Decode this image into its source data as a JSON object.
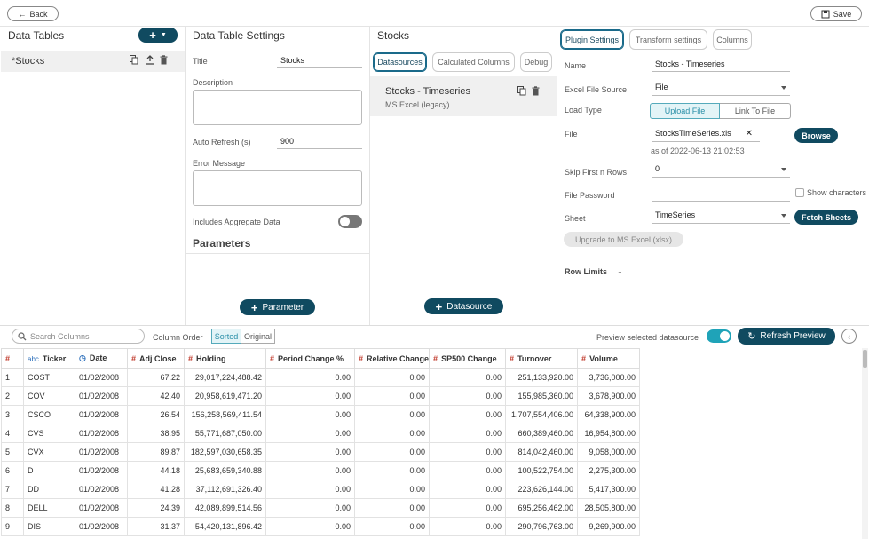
{
  "topbar": {
    "back_label": "Back",
    "save_label": "Save"
  },
  "data_tables": {
    "title": "Data Tables",
    "items": [
      {
        "label": "*Stocks"
      }
    ]
  },
  "settings": {
    "title": "Data Table Settings",
    "title_label": "Title",
    "title_value": "Stocks",
    "description_label": "Description",
    "auto_refresh_label": "Auto Refresh (s)",
    "auto_refresh_value": "900",
    "error_label": "Error Message",
    "aggregate_label": "Includes Aggregate Data",
    "parameters_title": "Parameters",
    "parameter_button": "Parameter"
  },
  "stocks": {
    "title": "Stocks",
    "tabs": [
      "Datasources",
      "Calculated Columns",
      "Debug"
    ],
    "datasource_name": "Stocks - Timeseries",
    "datasource_type": "MS Excel (legacy)",
    "datasource_button": "Datasource"
  },
  "plugin": {
    "tabs": [
      "Plugin Settings",
      "Transform settings",
      "Columns"
    ],
    "name_label": "Name",
    "name_value": "Stocks - Timeseries",
    "source_label": "Excel File Source",
    "source_value": "File",
    "load_label": "Load Type",
    "upload_label": "Upload File",
    "link_label": "Link To File",
    "file_label": "File",
    "file_value": "StocksTimeSeries.xls",
    "file_date": "as of 2022-06-13 21:02:53",
    "browse_label": "Browse",
    "skip_label": "Skip First n Rows",
    "skip_value": "0",
    "password_label": "File Password",
    "show_chars_label": "Show characters",
    "sheet_label": "Sheet",
    "sheet_value": "TimeSeries",
    "fetch_label": "Fetch Sheets",
    "upgrade_label": "Upgrade to MS Excel (xlsx)",
    "row_limits_label": "Row Limits"
  },
  "preview": {
    "search_placeholder": "Search Columns",
    "column_order_label": "Column Order",
    "sorted_label": "Sorted",
    "original_label": "Original",
    "preview_label": "Preview selected datasource",
    "refresh_label": "Refresh Preview",
    "columns": [
      {
        "icon": "#",
        "label": "#"
      },
      {
        "icon": "abc",
        "label": "Ticker"
      },
      {
        "icon": "clock",
        "label": "Date"
      },
      {
        "icon": "#",
        "label": "Adj Close"
      },
      {
        "icon": "#",
        "label": "Holding"
      },
      {
        "icon": "#",
        "label": "Period Change %"
      },
      {
        "icon": "#",
        "label": "Relative Change"
      },
      {
        "icon": "#",
        "label": "SP500 Change"
      },
      {
        "icon": "#",
        "label": "Turnover"
      },
      {
        "icon": "#",
        "label": "Volume"
      }
    ],
    "rows": [
      [
        "1",
        "COST",
        "01/02/2008",
        "67.22",
        "29,017,224,488.42",
        "0.00",
        "0.00",
        "0.00",
        "251,133,920.00",
        "3,736,000.00"
      ],
      [
        "2",
        "COV",
        "01/02/2008",
        "42.40",
        "20,958,619,471.20",
        "0.00",
        "0.00",
        "0.00",
        "155,985,360.00",
        "3,678,900.00"
      ],
      [
        "3",
        "CSCO",
        "01/02/2008",
        "26.54",
        "156,258,569,411.54",
        "0.00",
        "0.00",
        "0.00",
        "1,707,554,406.00",
        "64,338,900.00"
      ],
      [
        "4",
        "CVS",
        "01/02/2008",
        "38.95",
        "55,771,687,050.00",
        "0.00",
        "0.00",
        "0.00",
        "660,389,460.00",
        "16,954,800.00"
      ],
      [
        "5",
        "CVX",
        "01/02/2008",
        "89.87",
        "182,597,030,658.35",
        "0.00",
        "0.00",
        "0.00",
        "814,042,460.00",
        "9,058,000.00"
      ],
      [
        "6",
        "D",
        "01/02/2008",
        "44.18",
        "25,683,659,340.88",
        "0.00",
        "0.00",
        "0.00",
        "100,522,754.00",
        "2,275,300.00"
      ],
      [
        "7",
        "DD",
        "01/02/2008",
        "41.28",
        "37,112,691,326.40",
        "0.00",
        "0.00",
        "0.00",
        "223,626,144.00",
        "5,417,300.00"
      ],
      [
        "8",
        "DELL",
        "01/02/2008",
        "24.39",
        "42,089,899,514.56",
        "0.00",
        "0.00",
        "0.00",
        "695,256,462.00",
        "28,505,800.00"
      ],
      [
        "9",
        "DIS",
        "01/02/2008",
        "31.37",
        "54,420,131,896.42",
        "0.00",
        "0.00",
        "0.00",
        "290,796,763.00",
        "9,269,900.00"
      ]
    ]
  },
  "colors": {
    "accent": "#104a60",
    "toggle_on": "#1fa3b8",
    "header_icon": "#c0392b"
  }
}
